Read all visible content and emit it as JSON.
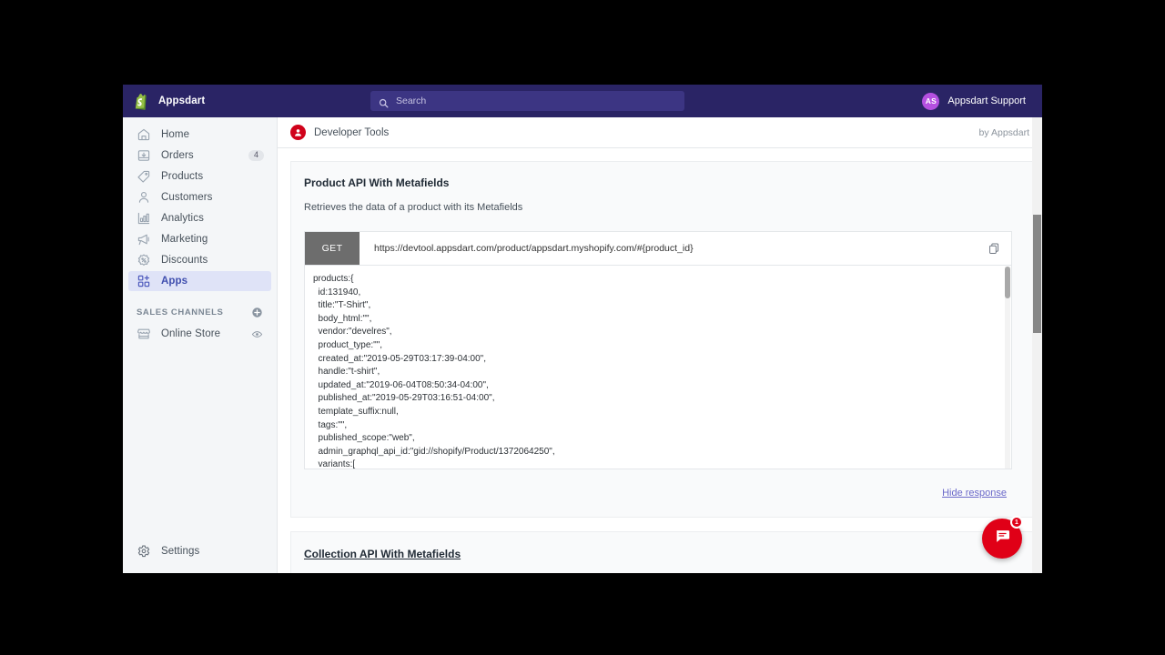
{
  "topbar": {
    "brand": "Appsdart",
    "logo_icon": "shopify-bag-icon",
    "search": {
      "placeholder": "Search",
      "value": "",
      "icon": "search-icon"
    },
    "user": {
      "initials": "AS",
      "name": "Appsdart Support",
      "avatar_color": "#b450e0"
    }
  },
  "sidebar": {
    "items": [
      {
        "label": "Home",
        "icon": "home-icon",
        "badge": "",
        "active": false
      },
      {
        "label": "Orders",
        "icon": "orders-inbox-icon",
        "badge": "4",
        "active": false
      },
      {
        "label": "Products",
        "icon": "tag-icon",
        "badge": "",
        "active": false
      },
      {
        "label": "Customers",
        "icon": "person-icon",
        "badge": "",
        "active": false
      },
      {
        "label": "Analytics",
        "icon": "bar-chart-icon",
        "badge": "",
        "active": false
      },
      {
        "label": "Marketing",
        "icon": "megaphone-icon",
        "badge": "",
        "active": false
      },
      {
        "label": "Discounts",
        "icon": "discount-percent-icon",
        "badge": "",
        "active": false
      },
      {
        "label": "Apps",
        "icon": "apps-grid-plus-icon",
        "badge": "",
        "active": true
      }
    ],
    "sales_channels": {
      "title": "SALES CHANNELS",
      "add_icon": "plus-circle-icon",
      "items": [
        {
          "label": "Online Store",
          "icon": "storefront-icon",
          "trailing_icon": "eye-icon"
        }
      ]
    },
    "settings": {
      "label": "Settings",
      "icon": "gear-icon"
    }
  },
  "app_header": {
    "icon": "developer-tools-app-icon",
    "title": "Developer Tools",
    "by": "by Appsdart"
  },
  "section_product": {
    "title": "Product API With Metafields",
    "subtitle": "Retrieves the data of a product with its Metafields",
    "method": "GET",
    "url": "https://devtool.appsdart.com/product/appsdart.myshopify.com/#{product_id}",
    "copy_icon": "copy-icon",
    "response": "products:{\n  id:131940,\n  title:\"T-Shirt\",\n  body_html:\"\",\n  vendor:\"develres\",\n  product_type:\"\",\n  created_at:\"2019-05-29T03:17:39-04:00\",\n  handle:\"t-shirt\",\n  updated_at:\"2019-06-04T08:50:34-04:00\",\n  published_at:\"2019-05-29T03:16:51-04:00\",\n  template_suffix:null,\n  tags:\"\",\n  published_scope:\"web\",\n  admin_graphql_api_id:\"gid://shopify/Product/1372064250\",\n  variants:[",
    "hide_response_label": "Hide response"
  },
  "section_collection": {
    "title": "Collection API With Metafields"
  },
  "chat": {
    "icon": "chat-message-icon",
    "badge": "1",
    "color": "#e00017"
  }
}
